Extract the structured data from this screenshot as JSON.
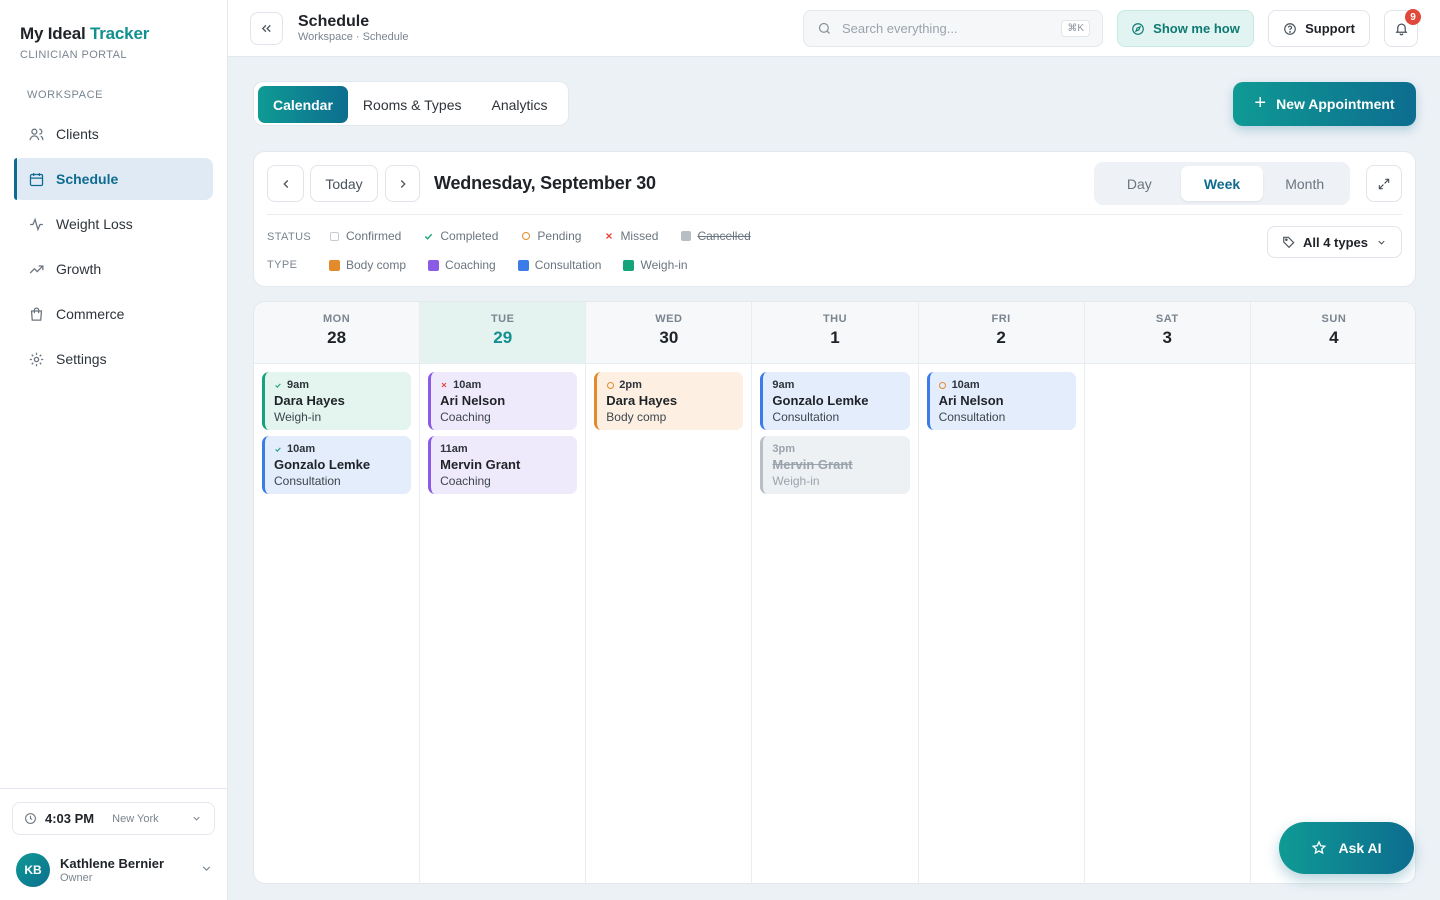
{
  "app": {
    "brand_main": "My Ideal",
    "brand_accent": "Tracker",
    "subtitle": "CLINICIAN PORTAL"
  },
  "sidebar": {
    "section_label": "WORKSPACE",
    "items": [
      {
        "label": "Clients",
        "icon": "users-icon"
      },
      {
        "label": "Schedule",
        "icon": "calendar-icon",
        "active": true
      },
      {
        "label": "Weight Loss",
        "icon": "activity-icon"
      },
      {
        "label": "Growth",
        "icon": "trending-up-icon"
      },
      {
        "label": "Commerce",
        "icon": "shopping-bag-icon"
      },
      {
        "label": "Settings",
        "icon": "gear-icon"
      }
    ],
    "clock": {
      "time": "4:03 PM",
      "timezone": "New York"
    },
    "user": {
      "initials": "KB",
      "name": "Kathlene Bernier",
      "role": "Owner"
    }
  },
  "header": {
    "title": "Schedule",
    "breadcrumb": "Workspace · Schedule",
    "search_placeholder": "Search everything...",
    "search_shortcut": "⌘K",
    "show_me_how": "Show me how",
    "support": "Support",
    "notification_count": "9"
  },
  "tabs": [
    "Calendar",
    "Rooms & Types",
    "Analytics"
  ],
  "new_appointment": "New Appointment",
  "controls": {
    "today": "Today",
    "date_title": "Wednesday, September 30",
    "views": [
      "Day",
      "Week",
      "Month"
    ],
    "active_view": "Week",
    "status_label": "STATUS",
    "statuses": [
      {
        "label": "Confirmed",
        "marker": "empty-square"
      },
      {
        "label": "Completed",
        "marker": "check"
      },
      {
        "label": "Pending",
        "marker": "circle"
      },
      {
        "label": "Missed",
        "marker": "cross"
      },
      {
        "label": "Cancelled",
        "marker": "gray-square"
      }
    ],
    "type_label": "TYPE",
    "types": [
      {
        "label": "Body comp",
        "color": "#e38b2c"
      },
      {
        "label": "Coaching",
        "color": "#8a5ce6"
      },
      {
        "label": "Consultation",
        "color": "#3b7ce8"
      },
      {
        "label": "Weigh-in",
        "color": "#14a37a"
      }
    ],
    "types_filter": "All 4 types"
  },
  "calendar": {
    "days": [
      {
        "dow": "MON",
        "num": "28",
        "events": [
          {
            "time": "9am",
            "name": "Dara Hayes",
            "type": "Weigh-in",
            "status": "completed"
          },
          {
            "time": "10am",
            "name": "Gonzalo Lemke",
            "type": "Consultation",
            "status": "completed"
          }
        ]
      },
      {
        "dow": "TUE",
        "num": "29",
        "today": true,
        "events": [
          {
            "time": "10am",
            "name": "Ari Nelson",
            "type": "Coaching",
            "status": "missed"
          },
          {
            "time": "11am",
            "name": "Mervin Grant",
            "type": "Coaching",
            "status": "confirmed"
          }
        ]
      },
      {
        "dow": "WED",
        "num": "30",
        "events": [
          {
            "time": "2pm",
            "name": "Dara Hayes",
            "type": "Body comp",
            "status": "pending"
          }
        ]
      },
      {
        "dow": "THU",
        "num": "1",
        "events": [
          {
            "time": "9am",
            "name": "Gonzalo Lemke",
            "type": "Consultation",
            "status": "confirmed"
          },
          {
            "time": "3pm",
            "name": "Mervin Grant",
            "type": "Weigh-in",
            "status": "cancelled"
          }
        ]
      },
      {
        "dow": "FRI",
        "num": "2",
        "events": [
          {
            "time": "10am",
            "name": "Ari Nelson",
            "type": "Consultation",
            "status": "pending"
          }
        ]
      },
      {
        "dow": "SAT",
        "num": "3",
        "events": []
      },
      {
        "dow": "SUN",
        "num": "4",
        "events": []
      }
    ]
  },
  "ask_ai": "Ask AI"
}
